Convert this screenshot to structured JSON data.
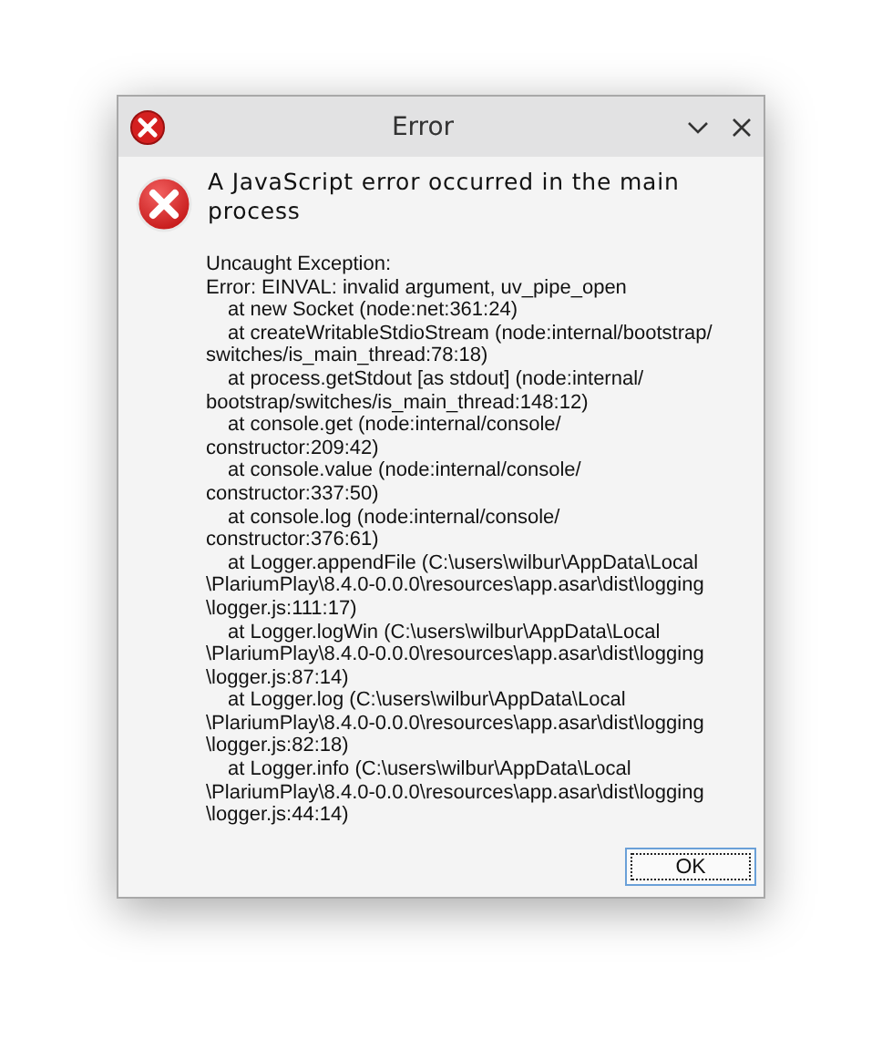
{
  "window": {
    "title": "Error"
  },
  "message": "A JavaScript error occurred in the main process",
  "details": [
    {
      "kind": "text",
      "text": "Uncaught Exception:"
    },
    {
      "kind": "text",
      "text": "Error: EINVAL: invalid argument, uv_pipe_open"
    },
    {
      "kind": "frame",
      "text": "at new Socket (node:net:361:24)"
    },
    {
      "kind": "frame",
      "text": "at createWritableStdioStream (node:internal/bootstrap/"
    },
    {
      "kind": "text",
      "text": "switches/is_main_thread:78:18)"
    },
    {
      "kind": "frame",
      "text": "at process.getStdout [as stdout] (node:internal/"
    },
    {
      "kind": "text",
      "text": "bootstrap/switches/is_main_thread:148:12)"
    },
    {
      "kind": "frame",
      "text": "at console.get (node:internal/console/"
    },
    {
      "kind": "text",
      "text": "constructor:209:42)"
    },
    {
      "kind": "frame",
      "text": "at console.value (node:internal/console/"
    },
    {
      "kind": "text",
      "text": "constructor:337:50)"
    },
    {
      "kind": "frame",
      "text": "at console.log (node:internal/console/"
    },
    {
      "kind": "text",
      "text": "constructor:376:61)"
    },
    {
      "kind": "frame",
      "text": "at Logger.appendFile (C:\\users\\wilbur\\AppData\\Local"
    },
    {
      "kind": "text",
      "text": "\\PlariumPlay\\8.4.0-0.0.0\\resources\\app.asar\\dist\\logging"
    },
    {
      "kind": "text",
      "text": "\\logger.js:111:17)"
    },
    {
      "kind": "frame",
      "text": "at Logger.logWin (C:\\users\\wilbur\\AppData\\Local"
    },
    {
      "kind": "text",
      "text": "\\PlariumPlay\\8.4.0-0.0.0\\resources\\app.asar\\dist\\logging"
    },
    {
      "kind": "text",
      "text": "\\logger.js:87:14)"
    },
    {
      "kind": "frame",
      "text": "at Logger.log (C:\\users\\wilbur\\AppData\\Local"
    },
    {
      "kind": "text",
      "text": "\\PlariumPlay\\8.4.0-0.0.0\\resources\\app.asar\\dist\\logging"
    },
    {
      "kind": "text",
      "text": "\\logger.js:82:18)"
    },
    {
      "kind": "frame",
      "text": "at Logger.info (C:\\users\\wilbur\\AppData\\Local"
    },
    {
      "kind": "text",
      "text": "\\PlariumPlay\\8.4.0-0.0.0\\resources\\app.asar\\dist\\logging"
    },
    {
      "kind": "text",
      "text": "\\logger.js:44:14)"
    }
  ],
  "buttons": [
    {
      "label": "OK",
      "focused": true
    }
  ]
}
